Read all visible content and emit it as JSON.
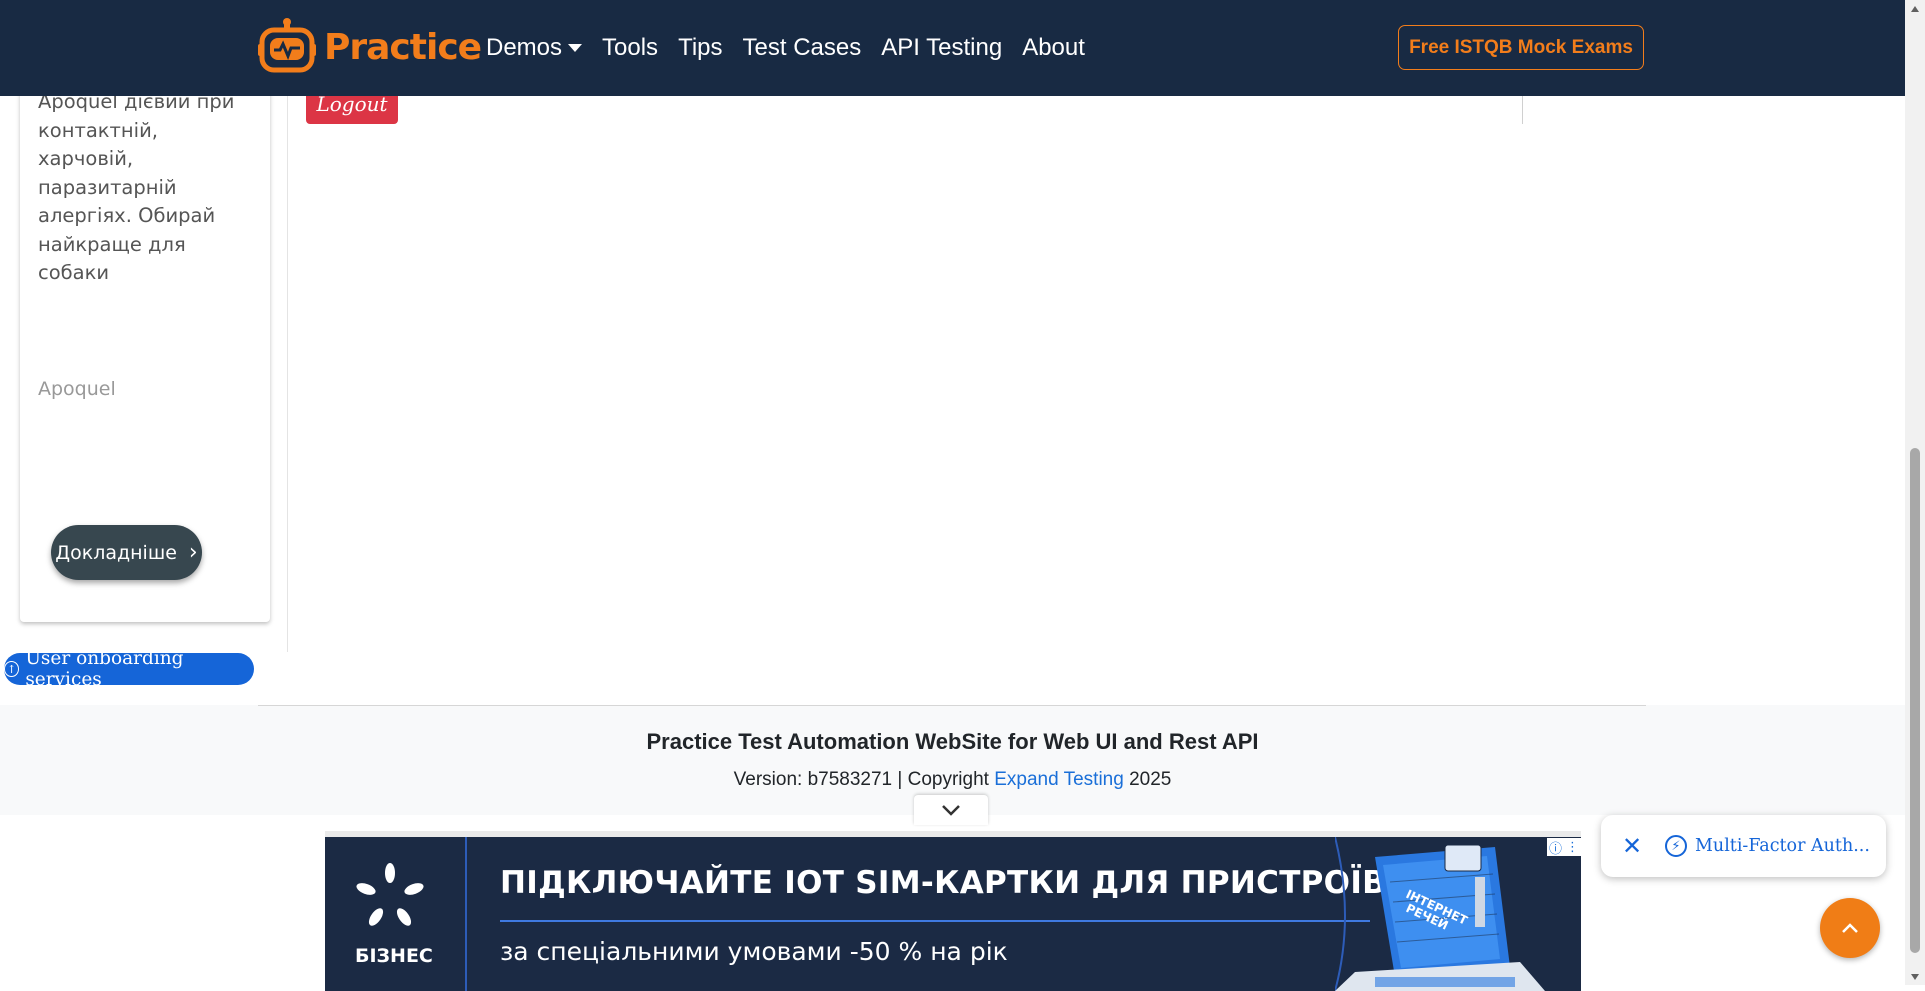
{
  "navbar": {
    "brand": "Practice",
    "links": [
      "Demos",
      "Tools",
      "Tips",
      "Test Cases",
      "API Testing",
      "About"
    ],
    "cta": "Free ISTQB Mock Exams"
  },
  "ad_card": {
    "description": "Apoquel дієвий при контактній, харчовій, паразитарній алергіях. Обирай найкраще для собаки",
    "brand": "Apoquel",
    "button": "Докладніше"
  },
  "main": {
    "logout": "Logout"
  },
  "onboarding": {
    "label": "User onboarding services"
  },
  "footer": {
    "title": "Practice Test Automation WebSite for Web UI and Rest API",
    "version_prefix": "Version: b7583271 | Copyright ",
    "link_text": "Expand Testing",
    "year_suffix": " 2025"
  },
  "banner_ad": {
    "logo_text": "БІЗНЕС",
    "headline": "ПІДКЛЮЧАЙТЕ IOT SIM-КАРТКИ ДЛЯ ПРИСТРОЇВ",
    "subline": "за спеціальними умовами -50 % на рік",
    "art_text": "ІНТЕРНЕТ РЕЧЕЙ"
  },
  "toast": {
    "text": "Multi-Factor Auth..."
  },
  "colors": {
    "navbar_bg": "#182a43",
    "accent_orange": "#f27d1b",
    "logout_red": "#dc3545",
    "link_blue": "#1a6fd8",
    "banner_bg": "#1b2a44"
  }
}
